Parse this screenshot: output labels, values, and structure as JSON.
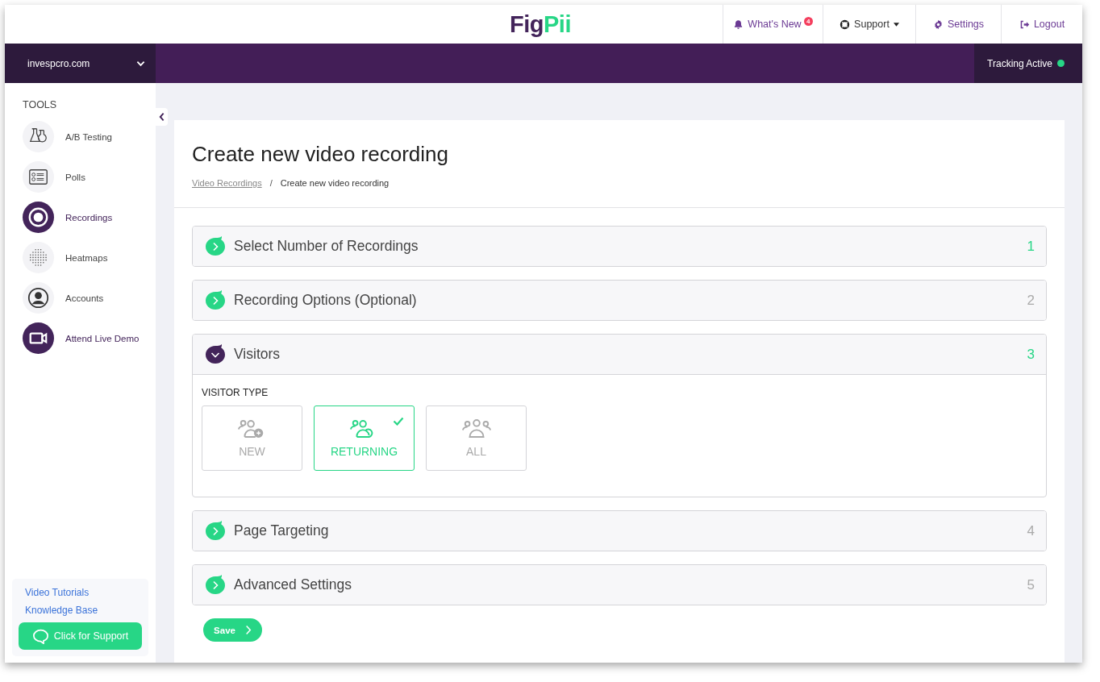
{
  "logo": {
    "part_1": "Fig",
    "part_2": "Pii"
  },
  "top_nav": [
    {
      "kind": "news",
      "label": "What's New",
      "badge": "4"
    },
    {
      "kind": "support",
      "label": "Support"
    },
    {
      "kind": "settings",
      "label": "Settings"
    },
    {
      "kind": "logout",
      "label": "Logout"
    }
  ],
  "account": {
    "name": "invespcro.com"
  },
  "tracking": {
    "label": "Tracking Active",
    "active": true
  },
  "sidebar": {
    "heading": "TOOLS",
    "items": [
      {
        "label": "A/B Testing",
        "selected": false
      },
      {
        "label": "Polls",
        "selected": false
      },
      {
        "label": "Recordings",
        "selected": true
      },
      {
        "label": "Heatmaps",
        "selected": false
      },
      {
        "label": "Accounts",
        "selected": false
      }
    ],
    "demo_link": "Attend Live Demo",
    "links": [
      "Video Tutorials",
      "Knowledge Base"
    ],
    "support_button": "Click for Support"
  },
  "page": {
    "title": "Create new video recording",
    "breadcrumb": [
      {
        "label": "Video Recordings",
        "link": true
      },
      {
        "label": "Create new video recording",
        "link": false
      }
    ],
    "breadcrumb_separator": "/"
  },
  "steps": [
    {
      "title": "Select Number of Recordings",
      "number": "1",
      "completed": true,
      "expanded": false
    },
    {
      "title": "Recording Options (Optional)",
      "number": "2",
      "completed": false,
      "expanded": false
    },
    {
      "title": "Visitors",
      "number": "3",
      "completed": true,
      "expanded": true
    },
    {
      "title": "Page Targeting",
      "number": "4",
      "completed": false,
      "expanded": false
    },
    {
      "title": "Advanced Settings",
      "number": "5",
      "completed": false,
      "expanded": false
    }
  ],
  "visitor_type": {
    "label": "VISITOR TYPE",
    "options": [
      {
        "kind": "new",
        "label": "NEW",
        "selected": false
      },
      {
        "kind": "returning",
        "label": "RETURNING",
        "selected": true
      },
      {
        "kind": "all",
        "label": "ALL",
        "selected": false
      }
    ]
  },
  "save_button": "Save"
}
